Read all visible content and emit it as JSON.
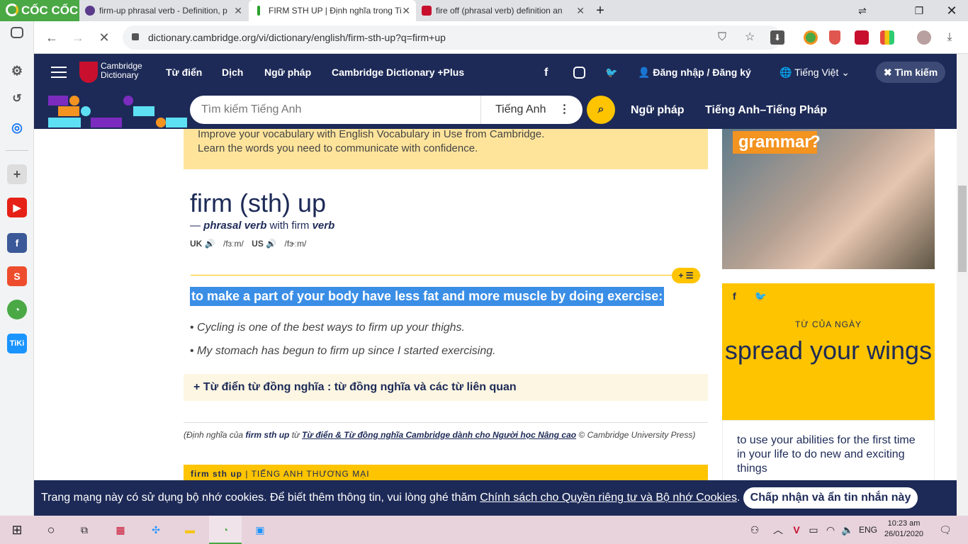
{
  "browser": {
    "brand": "CỐC CỐC",
    "tabs": [
      {
        "title": "firm-up phrasal verb - Definition, p",
        "active": false
      },
      {
        "title": "FIRM STH UP | Định nghĩa trong Ti",
        "active": true
      },
      {
        "title": "fire off (phrasal verb) definition an",
        "active": false
      }
    ],
    "url": "dictionary.cambridge.org/vi/dictionary/english/firm-sth-up?q=firm+up"
  },
  "site": {
    "logo_line1": "Cambridge",
    "logo_line2": "Dictionary",
    "nav": [
      "Từ điển",
      "Dịch",
      "Ngữ pháp",
      "Cambridge Dictionary +Plus"
    ],
    "login": "Đăng nhập / Đăng ký",
    "language": "Tiếng Việt",
    "search_toggle": "Tìm kiếm",
    "search_placeholder": "Tìm kiếm Tiếng Anh",
    "search_lang": "Tiếng Anh",
    "sub_nav": [
      "Ngữ pháp",
      "Tiếng Anh–Tiếng Pháp"
    ]
  },
  "entry": {
    "promo_line1": "Improve your vocabulary with English Vocabulary in Use from Cambridge.",
    "promo_line2": "Learn the words you need to communicate with confidence.",
    "headword": "firm (sth) up",
    "pos_prefix": "— ",
    "pos": "phrasal verb",
    "pos_with": " with firm ",
    "pos_verb": "verb",
    "uk_label": "UK",
    "uk_ipa": "/fɜːm/",
    "us_label": "US",
    "us_ipa": "/fɝːm/",
    "definition": "to make a part of your body have less fat and more muscle by doing exercise:",
    "examples": [
      "Cycling is one of the best ways to firm up your thighs.",
      "My stomach has begun to firm up since I started exercising."
    ],
    "thesaurus": "Từ điển từ đồng nghĩa : từ đồng nghĩa và các từ liên quan",
    "credit_prefix": "(Định nghĩa của ",
    "credit_word": "firm sth up",
    "credit_mid": " từ ",
    "credit_link": "Từ điển & Từ đồng nghĩa Cambridge dành cho Người học Nâng cao",
    "credit_suffix": " © Cambridge University Press)",
    "business_word": "firm sth up",
    "business_label": " | TIẾNG ANH THƯƠNG MẠI"
  },
  "sidebar": {
    "ad_text1": "grammar",
    "ad_text2": "?",
    "wotd_label": "TỪ CỦA NGÀY",
    "wotd_word": "spread your wings",
    "wotd_definition": "to use your abilities for the first time in your life to do new and exciting things"
  },
  "cookie": {
    "text": "Trang mạng này có sử dụng bộ nhớ cookies. Để biết thêm thông tin, vui lòng ghé thăm ",
    "link": "Chính sách cho Quyền riêng tư và Bộ nhớ Cookies",
    "text_end": ".",
    "button": "Chấp nhận và ẩn tin nhắn này"
  },
  "taskbar": {
    "lang": "ENG",
    "time": "10:23 am",
    "date": "26/01/2020"
  }
}
